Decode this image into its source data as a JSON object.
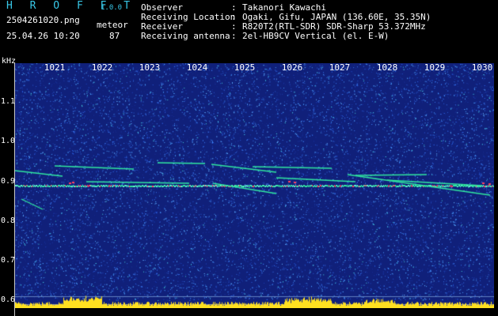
{
  "header": {
    "app_title": "H R O F F T",
    "version": "1.0.0",
    "filename": "2504261020.png",
    "datetime": "25.04.26 10:20",
    "meteor_label": "meteor",
    "meteor_count": "87",
    "separator": ":",
    "info": [
      {
        "key": "Observer",
        "value": "Takanori Kawachi"
      },
      {
        "key": "Receiving Location",
        "value": "Ogaki, Gifu, JAPAN (136.60E, 35.35N)"
      },
      {
        "key": "Receiver",
        "value": "R820T2(RTL-SDR) SDR-Sharp 53.372MHz"
      },
      {
        "key": "Receiving antenna",
        "value": "2el-HB9CV Vertical (el. E-W)"
      }
    ]
  },
  "spectrogram": {
    "y_unit": "kHz",
    "x_ticks": [
      "1021",
      "1022",
      "1023",
      "1024",
      "1025",
      "1026",
      "1027",
      "1028",
      "1029",
      "1030"
    ],
    "y_ticks": [
      "1.1",
      "1.0",
      "0.9",
      "0.8",
      "0.7",
      "0.6"
    ],
    "y_values": [
      1.1,
      1.0,
      0.9,
      0.8,
      0.7,
      0.6
    ],
    "x_values": [
      1021,
      1022,
      1023,
      1024,
      1025,
      1026,
      1027,
      1028,
      1029,
      1030
    ],
    "carrier_khz": 0.89,
    "colors": {
      "background": "#10207a",
      "noise": "#2a5cd8",
      "signal": "#30e8a0",
      "hot": "#ff4060",
      "level": "#ffe020",
      "title": "#38c8e8"
    }
  }
}
